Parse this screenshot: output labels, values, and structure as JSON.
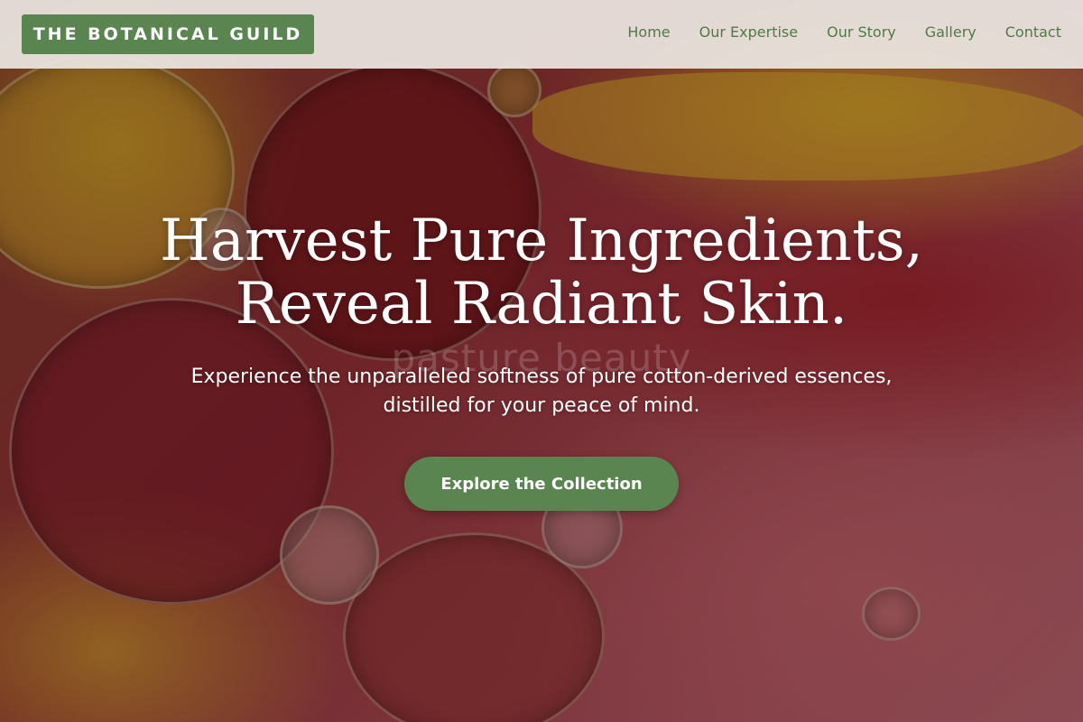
{
  "brand": {
    "name": "THE BOTANICAL GUILD"
  },
  "nav": {
    "items": [
      {
        "label": "Home"
      },
      {
        "label": "Our Expertise"
      },
      {
        "label": "Our Story"
      },
      {
        "label": "Gallery"
      },
      {
        "label": "Contact"
      }
    ]
  },
  "hero": {
    "headline_line1": "Harvest Pure Ingredients,",
    "headline_line2": "Reveal Radiant Skin.",
    "watermark": "pasture beauty",
    "subtext_line1": "Experience the unparalleled softness of pure cotton-derived essences,",
    "subtext_line2": "distilled for your peace of mind.",
    "cta_label": "Explore the Collection"
  },
  "colors": {
    "accent": "#5a8450",
    "nav_text": "#4f7a45",
    "header_bg": "#ece6e2"
  }
}
